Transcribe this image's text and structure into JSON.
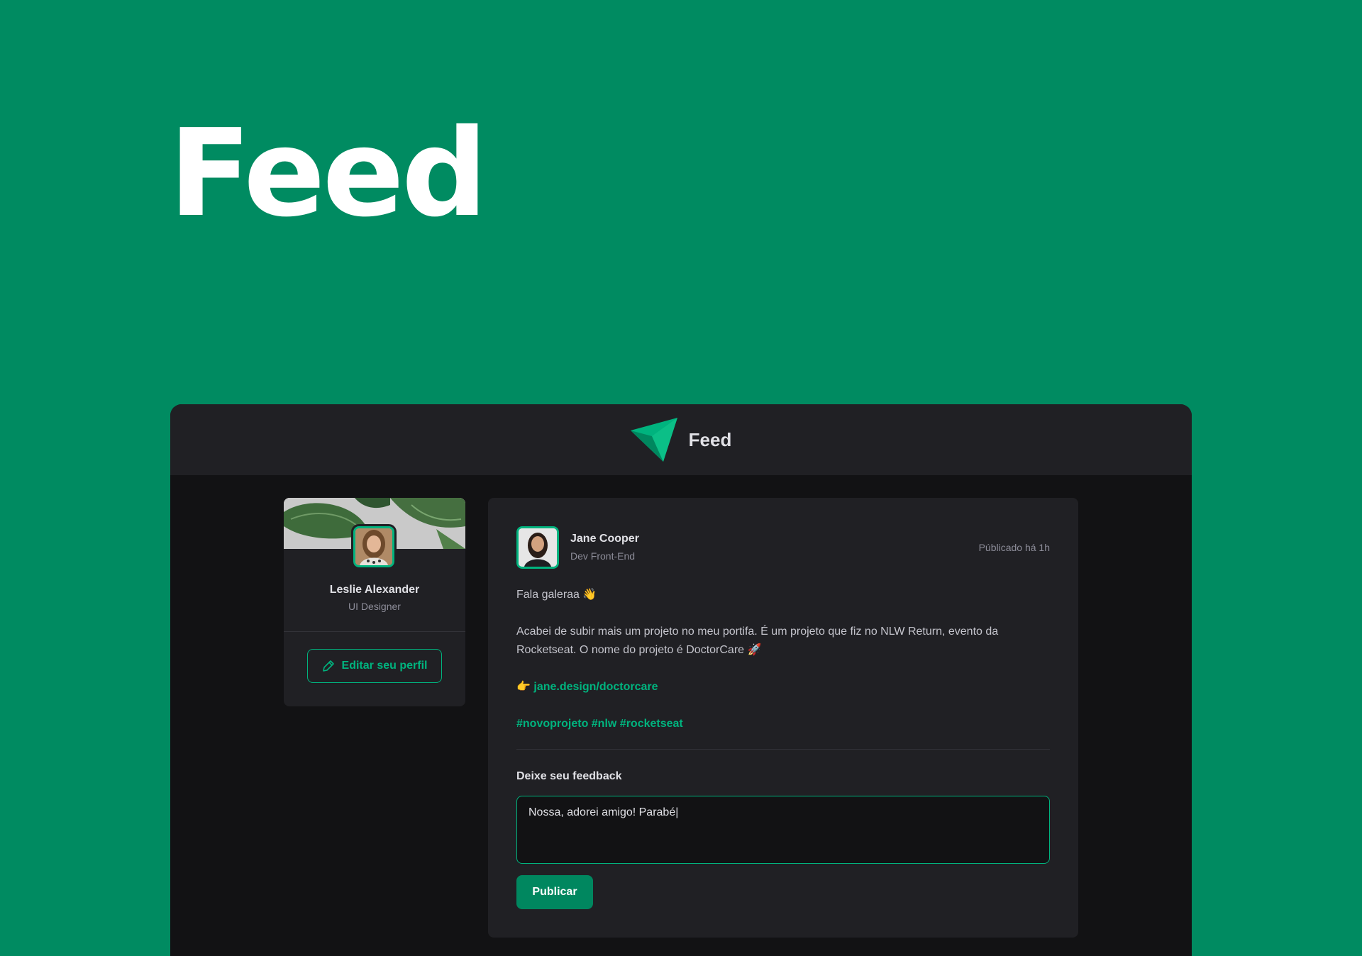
{
  "hero": {
    "title": "Feed"
  },
  "app": {
    "title": "Feed"
  },
  "sidebar": {
    "name": "Leslie Alexander",
    "role": "UI Designer",
    "edit_label": "Editar seu perfil"
  },
  "post": {
    "author_name": "Jane Cooper",
    "author_role": "Dev Front-End",
    "published": "Públicado há 1h",
    "greeting": "Fala galeraa 👋",
    "paragraph": "Acabei de subir mais um projeto no meu portifa. É um projeto que fiz no NLW Return, evento da Rocketseat. O nome do projeto é DoctorCare 🚀",
    "link_prefix": "👉 ",
    "link_text": "jane.design/doctorcare",
    "hashtags": "#novoprojeto #nlw #rocketseat"
  },
  "feedback": {
    "label": "Deixe seu feedback",
    "value": "Nossa, adorei amigo! Parabé|",
    "publish_label": "Publicar"
  },
  "colors": {
    "background": "#008b61",
    "accent": "#00b37e",
    "button": "#00875f",
    "panel": "#202024",
    "canvas": "#121214"
  },
  "icons": {
    "logo": "paper-plane-logo-icon",
    "edit": "pencil-icon"
  }
}
